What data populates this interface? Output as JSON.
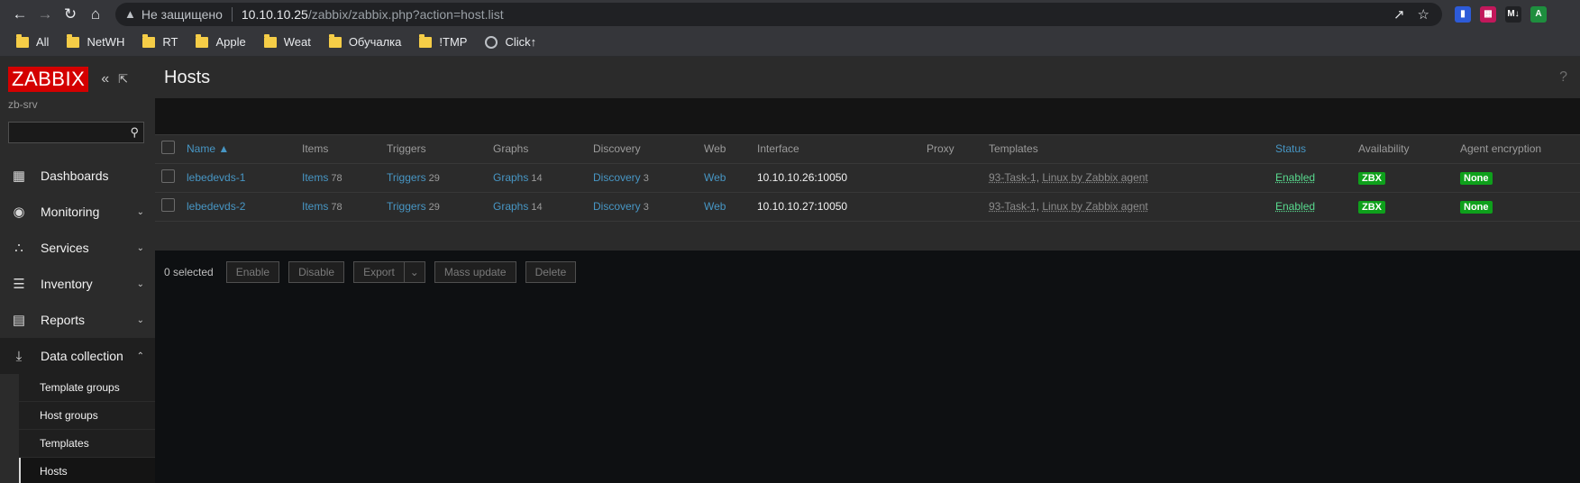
{
  "browser": {
    "security_label": "Не защищено",
    "url_host": "10.10.10.25",
    "url_path": "/zabbix/zabbix.php?action=host.list",
    "bookmarks": [
      "All",
      "NetWH",
      "RT",
      "Apple",
      "Weat",
      "Обучалка",
      "!TMP",
      "Click↑"
    ]
  },
  "sidebar": {
    "logo": "ZABBIX",
    "server": "zb-srv",
    "menu": [
      {
        "label": "Dashboards",
        "icon": "dashboard-icon"
      },
      {
        "label": "Monitoring",
        "icon": "eye-icon"
      },
      {
        "label": "Services",
        "icon": "services-icon"
      },
      {
        "label": "Inventory",
        "icon": "list-icon"
      },
      {
        "label": "Reports",
        "icon": "report-icon"
      },
      {
        "label": "Data collection",
        "icon": "download-icon"
      }
    ],
    "submenu": [
      "Template groups",
      "Host groups",
      "Templates",
      "Hosts"
    ]
  },
  "page": {
    "title": "Hosts",
    "help": "?"
  },
  "table": {
    "headers": {
      "name": "Name ▲",
      "items": "Items",
      "triggers": "Triggers",
      "graphs": "Graphs",
      "discovery": "Discovery",
      "web": "Web",
      "interface": "Interface",
      "proxy": "Proxy",
      "templates": "Templates",
      "status": "Status",
      "availability": "Availability",
      "encryption": "Agent encryption"
    },
    "rows": [
      {
        "name": "lebedevds-1",
        "items": "Items",
        "items_count": "78",
        "triggers": "Triggers",
        "triggers_count": "29",
        "graphs": "Graphs",
        "graphs_count": "14",
        "discovery": "Discovery",
        "discovery_count": "3",
        "web": "Web",
        "interface": "10.10.10.26:10050",
        "template1": "93-Task-1",
        "template2": "Linux by Zabbix agent",
        "status": "Enabled",
        "availability": "ZBX",
        "encryption": "None"
      },
      {
        "name": "lebedevds-2",
        "items": "Items",
        "items_count": "78",
        "triggers": "Triggers",
        "triggers_count": "29",
        "graphs": "Graphs",
        "graphs_count": "14",
        "discovery": "Discovery",
        "discovery_count": "3",
        "web": "Web",
        "interface": "10.10.10.27:10050",
        "template1": "93-Task-1",
        "template2": "Linux by Zabbix agent",
        "status": "Enabled",
        "availability": "ZBX",
        "encryption": "None"
      }
    ]
  },
  "actions": {
    "selected": "0 selected",
    "enable": "Enable",
    "disable": "Disable",
    "export": "Export",
    "mass_update": "Mass update",
    "delete": "Delete"
  }
}
